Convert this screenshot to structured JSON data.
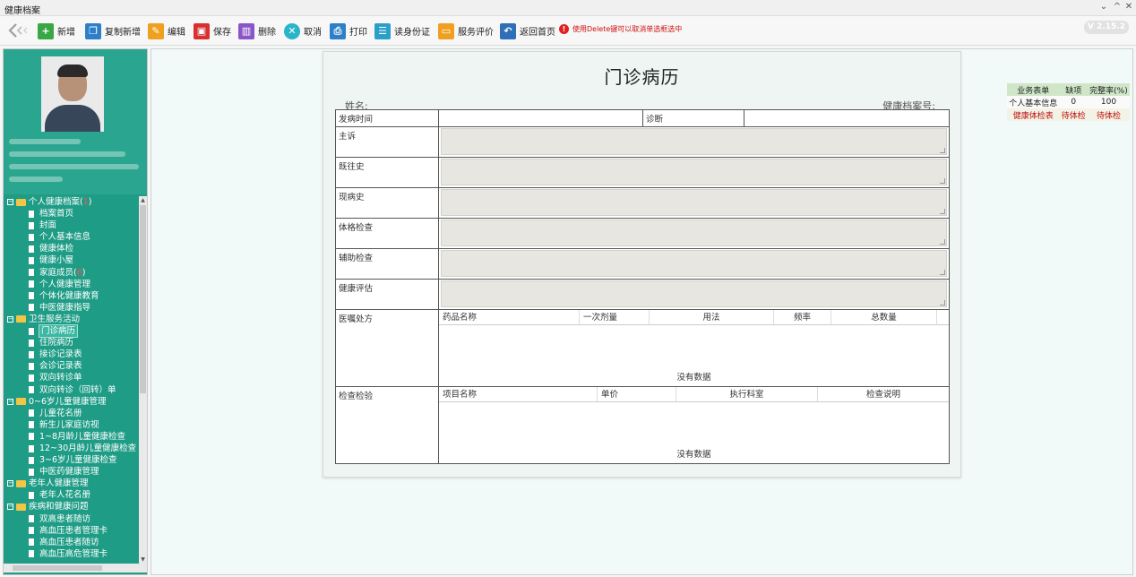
{
  "window": {
    "title": "健康档案"
  },
  "toolbar": {
    "buttons": [
      {
        "label": "新增",
        "icon": "add-icon",
        "color": "#3aa745"
      },
      {
        "label": "复制新增",
        "icon": "copy-icon",
        "color": "#2f7fc8"
      },
      {
        "label": "编辑",
        "icon": "edit-icon",
        "color": "#f0a020"
      },
      {
        "label": "保存",
        "icon": "save-icon",
        "color": "#d83030"
      },
      {
        "label": "删除",
        "icon": "trash-icon",
        "color": "#8a55c8"
      },
      {
        "label": "取消",
        "icon": "cancel-icon",
        "color": "#2ab4c8"
      },
      {
        "label": "打印",
        "icon": "print-icon",
        "color": "#2f7fc8"
      },
      {
        "label": "读身份证",
        "icon": "id-card-icon",
        "color": "#2aa0c8"
      },
      {
        "label": "服务评价",
        "icon": "comment-icon",
        "color": "#f0a020"
      },
      {
        "label": "返回首页",
        "icon": "return-icon",
        "color": "#2f6fb8"
      }
    ],
    "warning": "使用Delete键可以取消单选框选中",
    "version": "V 2.15.2"
  },
  "tree": {
    "items": [
      {
        "label": "个人健康档案",
        "suffix": "1",
        "level": 0
      },
      {
        "label": "档案首页",
        "level": 1
      },
      {
        "label": "封面",
        "level": 1
      },
      {
        "label": "个人基本信息",
        "level": 1
      },
      {
        "label": "健康体检",
        "level": 1
      },
      {
        "label": "健康小屋",
        "level": 1
      },
      {
        "label": "家庭成员",
        "suffix": "6",
        "level": 1
      },
      {
        "label": "个人健康管理",
        "level": 1
      },
      {
        "label": "个体化健康教育",
        "level": 1
      },
      {
        "label": "中医健康指导",
        "level": 1
      },
      {
        "label": "卫生服务活动",
        "level": 0
      },
      {
        "label": "门诊病历",
        "level": 1,
        "active": true
      },
      {
        "label": "住院病历",
        "level": 1
      },
      {
        "label": "接诊记录表",
        "level": 1
      },
      {
        "label": "会诊记录表",
        "level": 1
      },
      {
        "label": "双向转诊单",
        "level": 1
      },
      {
        "label": "双向转诊（回转）单",
        "level": 1
      },
      {
        "label": "0~6岁儿童健康管理",
        "level": 0
      },
      {
        "label": "儿童花名册",
        "level": 1
      },
      {
        "label": "新生儿家庭访视",
        "level": 1
      },
      {
        "label": "1~8月龄儿童健康检查",
        "level": 1
      },
      {
        "label": "12~30月龄儿童健康检查",
        "level": 1
      },
      {
        "label": "3~6岁儿童健康检查",
        "level": 1
      },
      {
        "label": "中医药健康管理",
        "level": 1
      },
      {
        "label": "老年人健康管理",
        "level": 0
      },
      {
        "label": "老年人花名册",
        "level": 1
      },
      {
        "label": "疾病和健康问题",
        "level": 0
      },
      {
        "label": "双高患者随访",
        "level": 1
      },
      {
        "label": "高血压患者管理卡",
        "level": 1
      },
      {
        "label": "高血压患者随访",
        "level": 1
      },
      {
        "label": "高血压高危管理卡",
        "level": 1
      }
    ]
  },
  "form": {
    "title": "门诊病历",
    "name_label": "姓名:",
    "record_no_label": "健康档案号:",
    "onset_label": "发病时间",
    "diagnosis_label": "诊断",
    "fields": [
      "主诉",
      "既往史",
      "现病史",
      "体格检查",
      "辅助检查",
      "健康评估"
    ],
    "prescription": {
      "label": "医嘱处方",
      "columns": [
        "药品名称",
        "一次剂量",
        "用法",
        "频率",
        "总数量"
      ],
      "empty": "没有数据"
    },
    "exam": {
      "label": "检查检验",
      "columns": [
        "项目名称",
        "单价",
        "执行科室",
        "检查说明"
      ],
      "empty": "没有数据"
    }
  },
  "stats": {
    "headers": [
      "业务表单",
      "缺项",
      "完整率(%)"
    ],
    "rows": [
      [
        "个人基本信息",
        "0",
        "100"
      ],
      [
        "健康体检表",
        "待体检",
        "待体检"
      ]
    ]
  }
}
